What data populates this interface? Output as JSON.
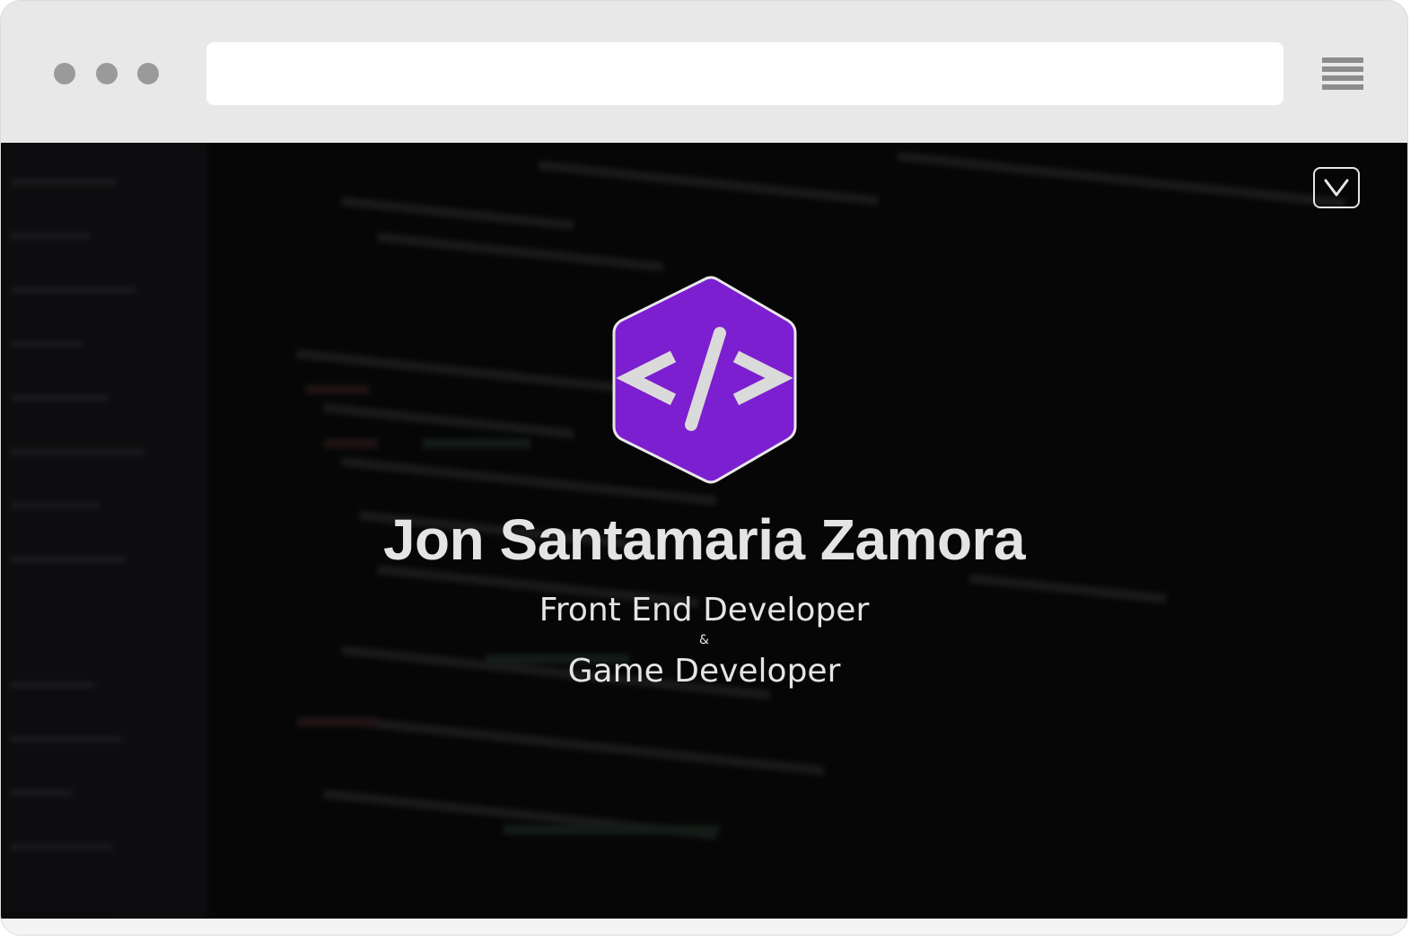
{
  "browser": {
    "address_value": "",
    "window_controls": [
      "dot",
      "dot",
      "dot"
    ],
    "menu_icon": "hamburger-icon"
  },
  "hero": {
    "scroll_button_icon": "chevron-down-icon",
    "logo_icon": "code-brackets-icon",
    "logo_color": "#7b1fd0",
    "name": "Jon Santamaria Zamora",
    "role_primary": "Front End Developer",
    "role_separator": "&",
    "role_secondary": "Game Developer"
  }
}
